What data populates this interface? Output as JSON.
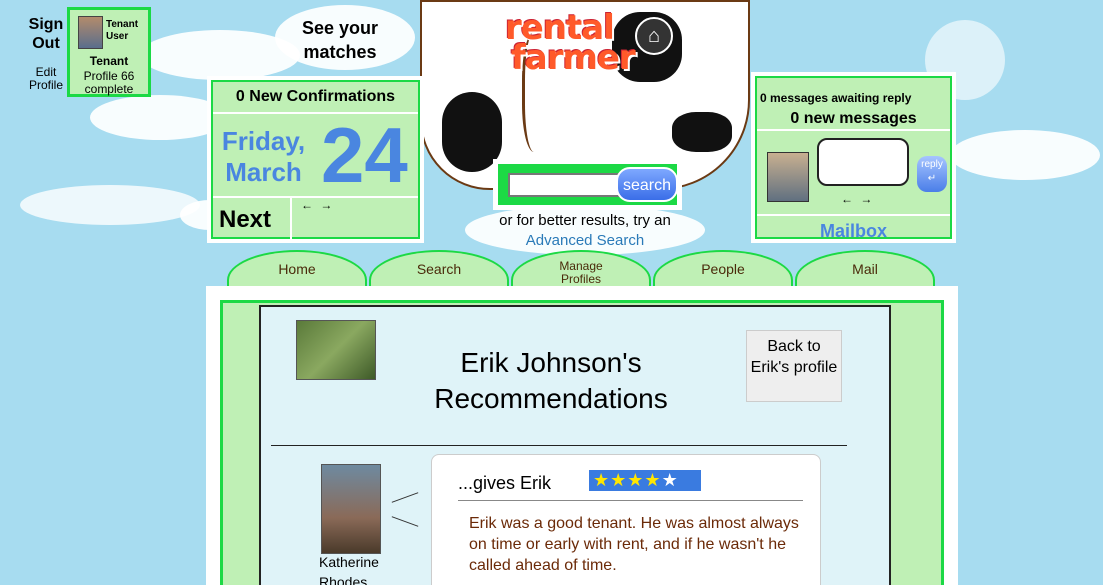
{
  "user": {
    "sign_out": "Sign Out",
    "edit_profile": "Edit Profile",
    "role_label": "Tenant User",
    "type": "Tenant",
    "profile_complete": "Profile 66 complete"
  },
  "header": {
    "see_matches": "See your matches",
    "logo_line1": "rental",
    "logo_line2": "farmer"
  },
  "calendar": {
    "confirmations": "0 New Confirmations",
    "day": "Friday, March",
    "date": "24",
    "next": "Next",
    "arrows": "← →"
  },
  "search": {
    "button": "search",
    "value": "",
    "hint": "or for better results, try an",
    "advanced": "Advanced Search"
  },
  "messages": {
    "awaiting": "0 messages awaiting reply",
    "new": "0 new messages",
    "reply": "reply",
    "arrows": "← →",
    "mailbox": "Mailbox"
  },
  "nav": {
    "tabs": [
      {
        "label": "Home"
      },
      {
        "label": "Search"
      },
      {
        "label": "Manage Profiles"
      },
      {
        "label": "People"
      },
      {
        "label": "Mail"
      }
    ]
  },
  "main": {
    "title": "Erik Johnson's Recommendations",
    "back_button": "Back to Erik's profile",
    "recommendation": {
      "author": "Katherine Rhodes",
      "gives": "...gives Erik",
      "rating": 4,
      "rating_max": 5,
      "text": "Erik was a good tenant. He was almost always on time or early with rent, and if he wasn't he called ahead of time."
    }
  },
  "colors": {
    "sky": "#a7dcf0",
    "panel_green": "#bff0b5",
    "border_green": "#1cd945",
    "accent_blue": "#4a86e0",
    "logo_orange": "#ff5a2a",
    "review_text": "#6b2a08"
  }
}
